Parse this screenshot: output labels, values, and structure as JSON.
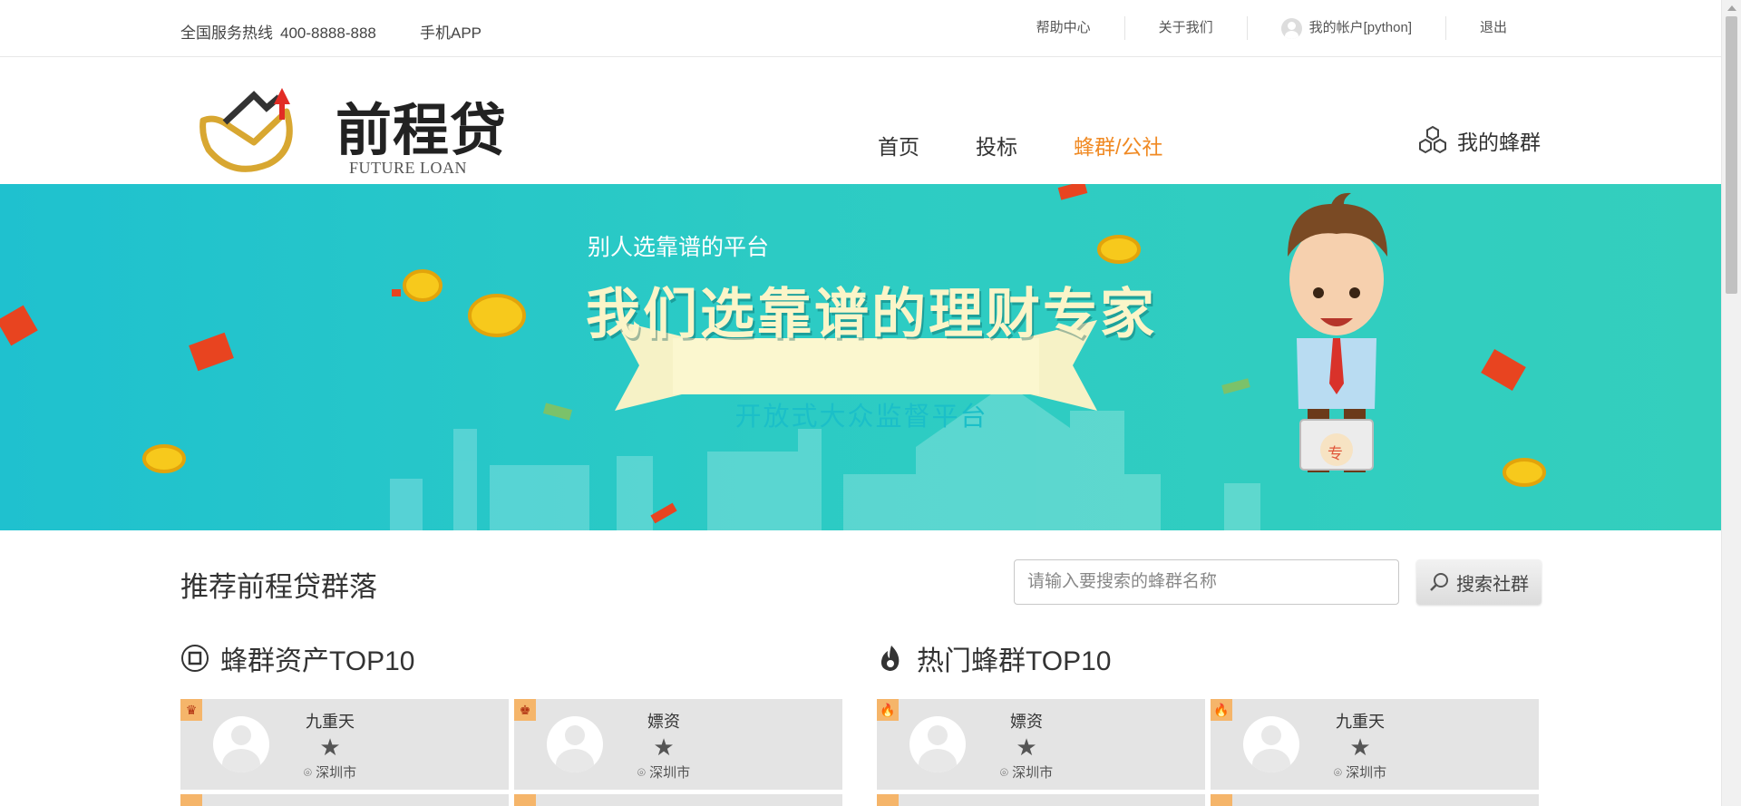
{
  "topbar": {
    "hotline_label": "全国服务热线",
    "hotline_number": "400-8888-888",
    "app_label": "手机APP",
    "links": {
      "help": "帮助中心",
      "about": "关于我们",
      "account": "我的帐户[python]",
      "logout": "退出"
    }
  },
  "header": {
    "logo_title": "前程贷",
    "logo_subtitle": "FUTURE LOAN",
    "nav": {
      "home": "首页",
      "invest": "投标",
      "hive": "蜂群/公社"
    },
    "nav_active": "蜂群/公社",
    "my_hive": "我的蜂群"
  },
  "banner": {
    "small_text": "别人选靠谱的平台",
    "slogan": "我们选靠谱的理财专家",
    "ribbon": "开放式大众监督平台",
    "briefcase_char": "专"
  },
  "recommend": {
    "title": "推荐前程贷群落",
    "search_placeholder": "请输入要搜索的蜂群名称",
    "search_button": "搜索社群"
  },
  "rankings": {
    "assets": {
      "title": "蜂群资产TOP10",
      "cards": [
        {
          "name": "九重天",
          "city": "深圳市",
          "badge": "♛"
        },
        {
          "name": "嫖资",
          "city": "深圳市",
          "badge": "♚"
        }
      ]
    },
    "hot": {
      "title": "热门蜂群TOP10",
      "cards": [
        {
          "name": "嫖资",
          "city": "深圳市",
          "badge": "🔥"
        },
        {
          "name": "九重天",
          "city": "深圳市",
          "badge": "🔥"
        }
      ]
    }
  },
  "colors": {
    "accent": "#f08a24",
    "banner_start": "#1fc1cf",
    "banner_end": "#34cfbd",
    "card_bg": "#e4e4e4",
    "slogan": "#fbf5c8"
  },
  "icons": {
    "my_hive": "hexagon-cluster-icon",
    "search": "magnifier-icon",
    "assets": "coin-icon",
    "hot": "flame-icon",
    "location": "map-pin-icon",
    "rating": "star-icon"
  }
}
